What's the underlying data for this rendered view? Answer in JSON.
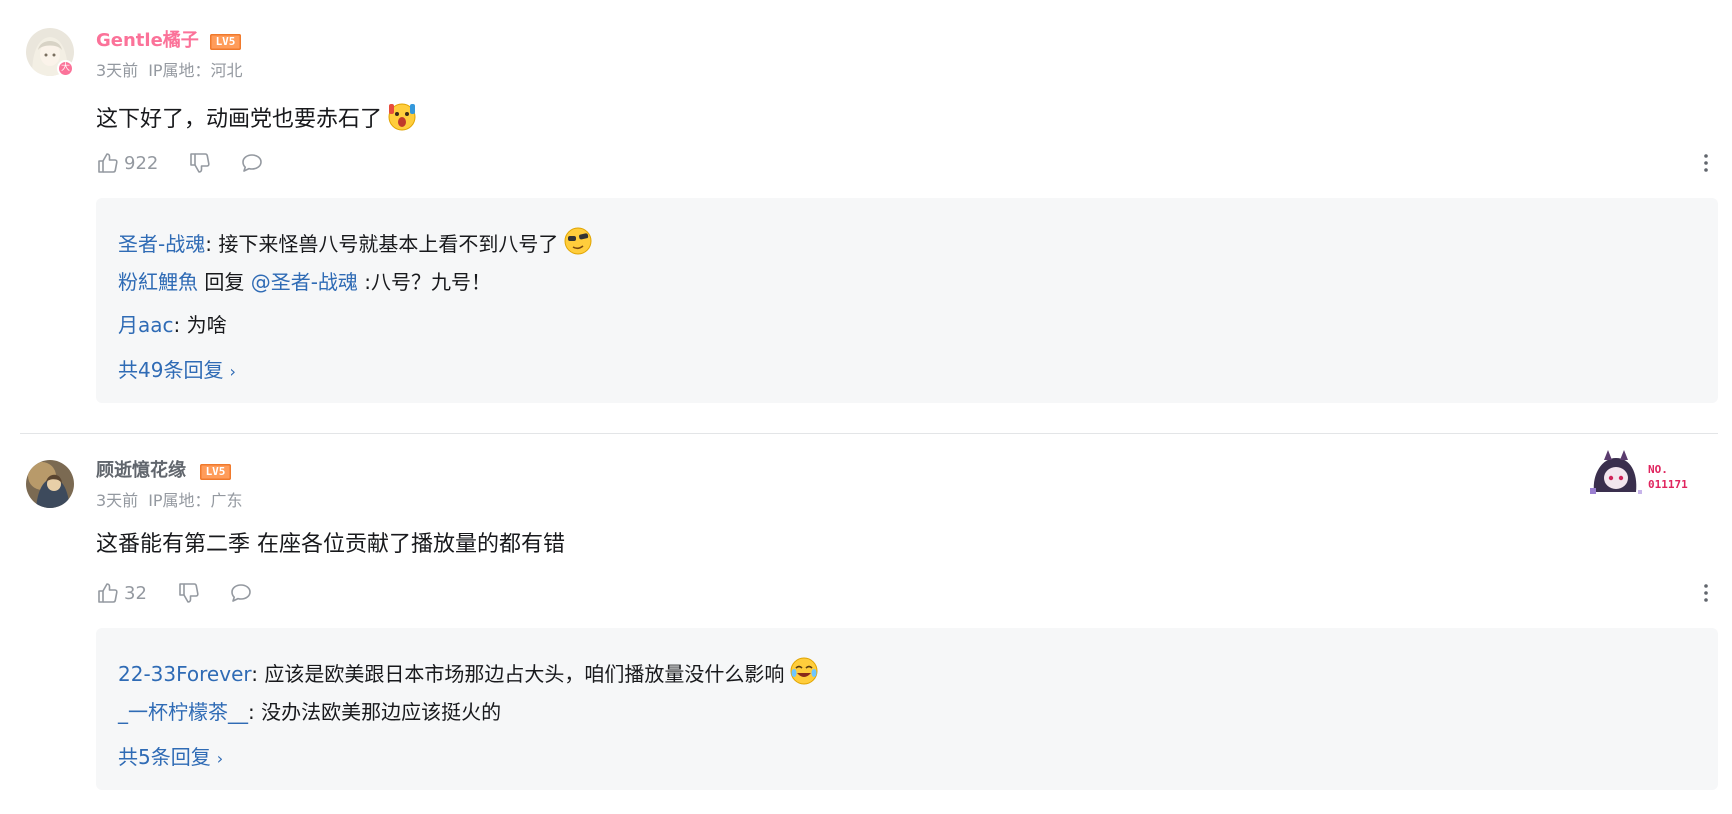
{
  "comments": [
    {
      "username": "Gentle橘子",
      "username_color": "#fb7299",
      "level": "LV5",
      "avatar_badge": "大",
      "time": "3天前",
      "ip": "IP属地：河北",
      "content": "这下好了，动画党也要赤石了",
      "content_emoji": "surprised-emoji",
      "likes": "922",
      "replies": [
        {
          "user": "圣者-战魂",
          "sep": ": ",
          "text": "接下来怪兽八号就基本上看不到八号了",
          "emoji": "sunglasses-emoji"
        },
        {
          "user": "粉紅鯉魚",
          "reply_word": " 回复 ",
          "at": "@圣者-战魂",
          "text": " :八号？九号！"
        },
        {
          "user": "月aac",
          "sep": ": ",
          "text": "为啥"
        }
      ],
      "more_replies": "共49条回复"
    },
    {
      "username": "顾逝憶花缘",
      "username_color": "#61666d",
      "level": "LV5",
      "time": "3天前",
      "ip": "IP属地：广东",
      "decoration_text": [
        "NO.",
        "011171"
      ],
      "content": "这番能有第二季 在座各位贡献了播放量的都有错",
      "likes": "32",
      "replies": [
        {
          "user": "22-33Forever",
          "sep": ": ",
          "text": "应该是欧美跟日本市场那边占大头，咱们播放量没什么影响",
          "emoji": "laughing-tears-emoji"
        },
        {
          "user": "_一杯柠檬茶__",
          "sep": ": ",
          "text": "没办法欧美那边应该挺火的"
        }
      ],
      "more_replies": "共5条回复"
    }
  ],
  "colors": {
    "link_blue": "#2f6bb5",
    "meta_gray": "#9499a0",
    "reply_bg": "#f6f7f8",
    "level_orange": "#ff9c5a"
  }
}
